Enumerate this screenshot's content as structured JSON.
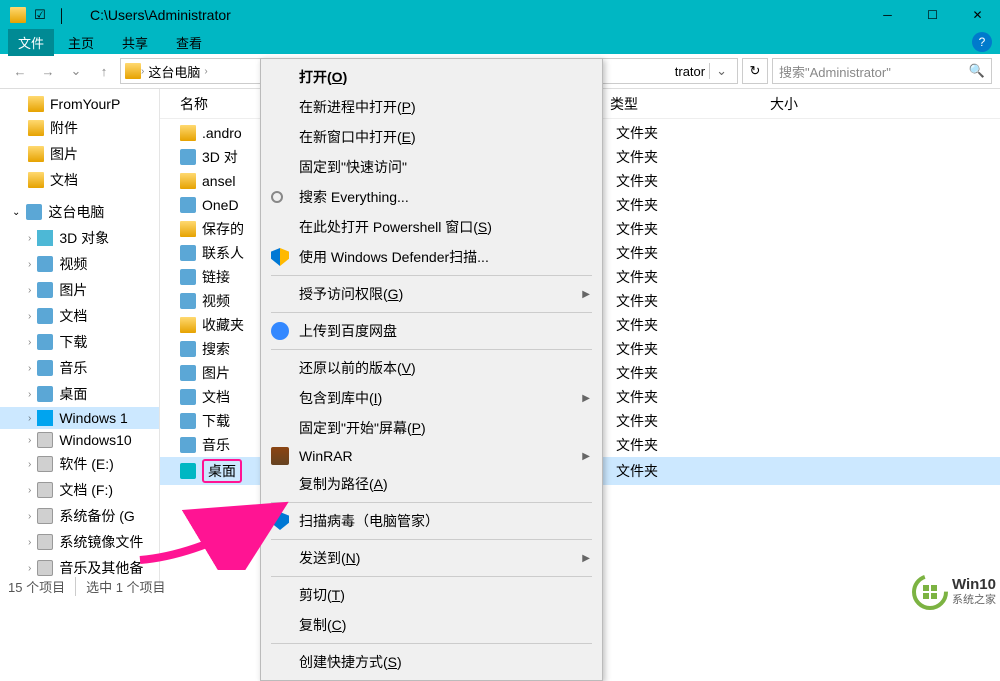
{
  "titlebar": {
    "title": "C:\\Users\\Administrator"
  },
  "menubar": {
    "file": "文件",
    "home": "主页",
    "share": "共享",
    "view": "查看"
  },
  "navbar": {
    "breadcrumb": [
      "这台电脑",
      ""
    ],
    "trator": "trator",
    "search_placeholder": "搜索\"Administrator\""
  },
  "columns": {
    "name": "名称",
    "type": "类型",
    "size": "大小"
  },
  "sidebar": {
    "items": [
      {
        "label": "FromYourP",
        "icon": "folder"
      },
      {
        "label": "附件",
        "icon": "folder"
      },
      {
        "label": "图片",
        "icon": "folder"
      },
      {
        "label": "文档",
        "icon": "folder"
      }
    ],
    "pc_root": "这台电脑",
    "pc_items": [
      {
        "label": "3D 对象",
        "icon": "obj"
      },
      {
        "label": "视频",
        "icon": "special"
      },
      {
        "label": "图片",
        "icon": "special"
      },
      {
        "label": "文档",
        "icon": "special"
      },
      {
        "label": "下载",
        "icon": "special"
      },
      {
        "label": "音乐",
        "icon": "music"
      },
      {
        "label": "桌面",
        "icon": "desktop"
      },
      {
        "label": "Windows 1",
        "icon": "win",
        "selected": true
      },
      {
        "label": "Windows10",
        "icon": "disk"
      },
      {
        "label": "软件 (E:)",
        "icon": "disk"
      },
      {
        "label": "文档 (F:)",
        "icon": "disk"
      },
      {
        "label": "系统备份 (G",
        "icon": "disk"
      },
      {
        "label": "系统镜像文件",
        "icon": "disk"
      },
      {
        "label": "音乐及其他备",
        "icon": "disk"
      }
    ]
  },
  "files": [
    {
      "name": ".andro",
      "type": "文件夹",
      "icon": "yellow"
    },
    {
      "name": "3D 对",
      "type": "文件夹",
      "icon": "special"
    },
    {
      "name": "ansel",
      "type": "文件夹",
      "icon": "yellow"
    },
    {
      "name": "OneD",
      "type": "文件夹",
      "icon": "cloud"
    },
    {
      "name": "保存的",
      "type": "文件夹",
      "icon": "yellow"
    },
    {
      "name": "联系人",
      "type": "文件夹",
      "icon": "special"
    },
    {
      "name": "链接",
      "type": "文件夹",
      "icon": "special"
    },
    {
      "name": "视频",
      "type": "文件夹",
      "icon": "special"
    },
    {
      "name": "收藏夹",
      "type": "文件夹",
      "icon": "yellow"
    },
    {
      "name": "搜索",
      "type": "文件夹",
      "icon": "special"
    },
    {
      "name": "图片",
      "type": "文件夹",
      "icon": "special"
    },
    {
      "name": "文档",
      "type": "文件夹",
      "icon": "special"
    },
    {
      "name": "下载",
      "type": "文件夹",
      "icon": "special"
    },
    {
      "name": "音乐",
      "type": "文件夹",
      "icon": "music"
    },
    {
      "name": "桌面",
      "type": "文件夹",
      "icon": "desktop",
      "highlighted": true
    }
  ],
  "context_menu": [
    {
      "label": "打开(O)",
      "u": "O",
      "default": true
    },
    {
      "label": "在新进程中打开(P)",
      "u": "P"
    },
    {
      "label": "在新窗口中打开(E)",
      "u": "E"
    },
    {
      "label": "固定到\"快速访问\""
    },
    {
      "label": "搜索 Everything...",
      "icon": "search"
    },
    {
      "label": "在此处打开 Powershell 窗口(S)",
      "u": "S"
    },
    {
      "label": "使用 Windows Defender扫描...",
      "icon": "shield"
    },
    {
      "sep": true
    },
    {
      "label": "授予访问权限(G)",
      "u": "G",
      "submenu": true
    },
    {
      "sep": true
    },
    {
      "label": "上传到百度网盘",
      "icon": "baidu"
    },
    {
      "sep": true
    },
    {
      "label": "还原以前的版本(V)",
      "u": "V"
    },
    {
      "label": "包含到库中(I)",
      "u": "I",
      "submenu": true
    },
    {
      "label": "固定到\"开始\"屏幕(P)",
      "u": "P"
    },
    {
      "label": "WinRAR",
      "icon": "rar",
      "submenu": true
    },
    {
      "label": "复制为路径(A)",
      "u": "A"
    },
    {
      "sep": true
    },
    {
      "label": "扫描病毒（电脑管家）",
      "icon": "shield-blue"
    },
    {
      "sep": true
    },
    {
      "label": "发送到(N)",
      "u": "N",
      "submenu": true
    },
    {
      "sep": true
    },
    {
      "label": "剪切(T)",
      "u": "T"
    },
    {
      "label": "复制(C)",
      "u": "C"
    },
    {
      "sep": true
    },
    {
      "label": "创建快捷方式(S)",
      "u": "S"
    }
  ],
  "statusbar": {
    "count": "15 个项目",
    "selected": "选中 1 个项目"
  },
  "watermark": {
    "top": "Win10",
    "bottom": "系统之家"
  }
}
